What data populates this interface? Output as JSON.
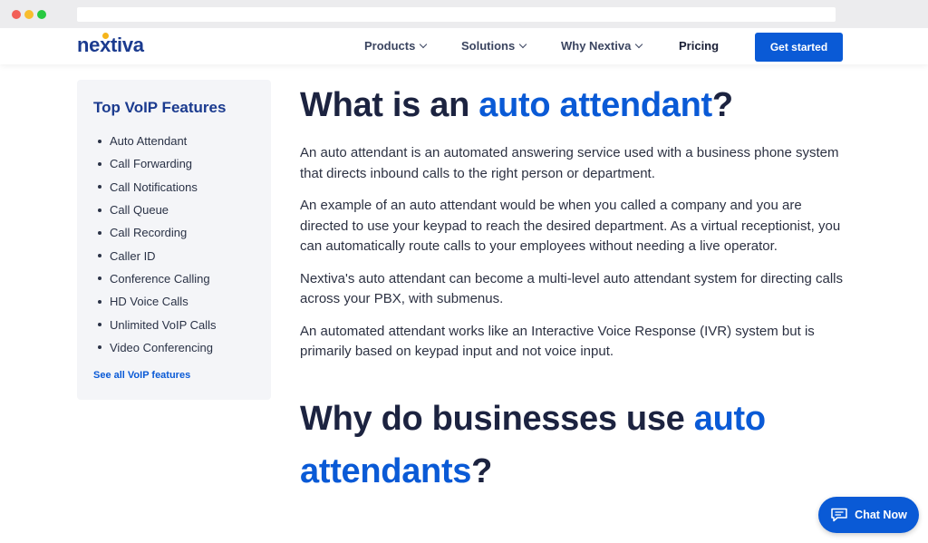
{
  "brand": {
    "name": "nextiva"
  },
  "nav": {
    "products": "Products",
    "solutions": "Solutions",
    "why": "Why Nextiva",
    "pricing": "Pricing",
    "cta": "Get started"
  },
  "sidebar": {
    "title": "Top VoIP Features",
    "items": [
      "Auto Attendant",
      "Call Forwarding",
      "Call Notifications",
      "Call Queue",
      "Call Recording",
      "Caller ID",
      "Conference Calling",
      "HD Voice Calls",
      "Unlimited VoIP Calls",
      "Video Conferencing"
    ],
    "see_all": "See all VoIP features"
  },
  "article": {
    "h1_prefix": "What is an ",
    "h1_highlight": "auto attendant",
    "h1_suffix": "?",
    "paragraphs": [
      "An auto attendant is an automated answering service used with a business phone system that directs inbound calls to the right person or department.",
      "An example of an auto attendant would be when you called a company and you are directed to use your keypad to reach the desired department. As a virtual receptionist, you can automatically route calls to your employees without needing a live operator.",
      "Nextiva's auto attendant can become a multi-level auto attendant system for directing calls across your PBX, with submenus.",
      "An automated attendant works like an Interactive Voice Response (IVR) system but is primarily based on keypad input and not voice input."
    ],
    "h2_prefix": "Why do businesses use ",
    "h2_highlight": "auto attendants",
    "h2_suffix": "?"
  },
  "chat": {
    "label": "Chat Now"
  },
  "colors": {
    "brand_blue": "#0a5ad6",
    "navy": "#1b3b8f",
    "heading": "#1c2340",
    "logo_dot": "#f5b41a"
  }
}
